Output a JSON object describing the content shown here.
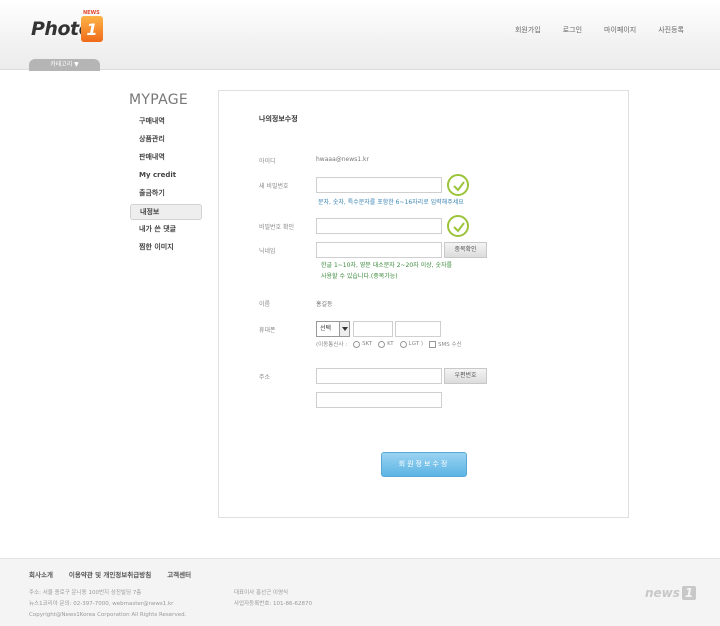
{
  "header": {
    "logo_text": "Photo",
    "logo_number": "1",
    "logo_sub": "NEWS",
    "nav": [
      "회원가입",
      "로그인",
      "마이페이지",
      "사진등록"
    ],
    "category_tab": "카테고리 ▼"
  },
  "sidebar": {
    "title": "MYPAGE",
    "items": [
      {
        "label": "구매내역"
      },
      {
        "label": "상품관리"
      },
      {
        "label": "판매내역"
      },
      {
        "label": "My credit"
      },
      {
        "label": "출금하기"
      },
      {
        "label": "내정보",
        "active": true
      },
      {
        "label": "내가 쓴 댓글"
      },
      {
        "label": "찜한 이미지"
      }
    ]
  },
  "form": {
    "title": "나의정보수정",
    "id_label": "아이디",
    "id_value": "hwaaa@news1.kr",
    "new_password_label": "새 비밀번호",
    "password_hint": "문자, 숫자, 특수문자를 포함한 6~16자리로 입력해주세요",
    "confirm_password_label": "비밀번호 확인",
    "nickname_label": "닉네임",
    "dup_check_button": "중복확인",
    "nickname_hint_1": "한글 1~10자, 영문 대소문자 2~20자 이상, 숫자를",
    "nickname_hint_2": "사용할 수 있습니다.(중복가능)",
    "name_label": "이름",
    "name_value": "홍길동",
    "phone_label": "휴대폰",
    "phone_select": "선택",
    "carrier_label": "(이동통신사 :",
    "carriers": [
      "SKT",
      "KT",
      "LGT )"
    ],
    "sms_label": "SMS 수신",
    "address_label": "주소",
    "zipcode_button": "우편번호",
    "submit_button": "회원정보수정"
  },
  "footer": {
    "links": [
      "회사소개",
      "이용약관 및 개인정보취급방침",
      "고객센터"
    ],
    "info_lines": [
      "주소: 서울 종로구 운니동 100번지 상진빌딩 7층",
      "뉴스1코리아 문의: 02-397-7000, webmaster@news1.kr",
      "Copyright@News1Korea Corporation All Rights Reserved."
    ],
    "info2_lines": [
      "대표이사 홍선근 이영식",
      "사업자등록번호: 101-86-62870"
    ],
    "brand": "news",
    "brand_number": "1"
  }
}
